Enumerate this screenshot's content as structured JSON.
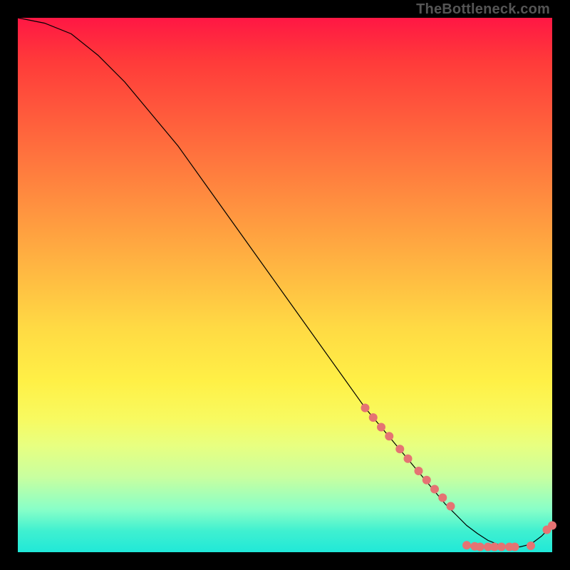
{
  "watermark": "TheBottleneck.com",
  "colors": {
    "background": "#000000",
    "marker": "#e57373",
    "line": "#000000",
    "gradient_top": "#ff1744",
    "gradient_bottom": "#20e8d8"
  },
  "chart_data": {
    "type": "line",
    "title": "",
    "xlabel": "",
    "ylabel": "",
    "xlim": [
      0,
      100
    ],
    "ylim": [
      0,
      100
    ],
    "grid": false,
    "legend": false,
    "series": [
      {
        "name": "curve",
        "x": [
          0,
          5,
          10,
          15,
          20,
          25,
          30,
          35,
          40,
          45,
          50,
          55,
          60,
          65,
          70,
          75,
          80,
          82,
          84,
          86,
          88,
          90,
          92,
          94,
          96,
          98,
          100
        ],
        "values": [
          100,
          99,
          97,
          93,
          88,
          82,
          76,
          69,
          62,
          55,
          48,
          41,
          34,
          27,
          21,
          15,
          9,
          7,
          5,
          3.5,
          2.2,
          1.4,
          1,
          1,
          1.5,
          3,
          5
        ]
      }
    ],
    "markers": [
      {
        "x": 65.0,
        "y": 27.0
      },
      {
        "x": 66.5,
        "y": 25.2
      },
      {
        "x": 68.0,
        "y": 23.4
      },
      {
        "x": 69.5,
        "y": 21.7
      },
      {
        "x": 71.5,
        "y": 19.3
      },
      {
        "x": 73.0,
        "y": 17.5
      },
      {
        "x": 75.0,
        "y": 15.2
      },
      {
        "x": 76.5,
        "y": 13.5
      },
      {
        "x": 78.0,
        "y": 11.8
      },
      {
        "x": 79.5,
        "y": 10.2
      },
      {
        "x": 81.0,
        "y": 8.6
      },
      {
        "x": 84.0,
        "y": 1.3
      },
      {
        "x": 85.5,
        "y": 1.1
      },
      {
        "x": 86.5,
        "y": 1.0
      },
      {
        "x": 88.0,
        "y": 1.0
      },
      {
        "x": 89.2,
        "y": 1.0
      },
      {
        "x": 90.5,
        "y": 1.0
      },
      {
        "x": 92.0,
        "y": 1.0
      },
      {
        "x": 93.0,
        "y": 1.0
      },
      {
        "x": 96.0,
        "y": 1.2
      },
      {
        "x": 99.0,
        "y": 4.2
      },
      {
        "x": 100.0,
        "y": 5.0
      }
    ]
  }
}
